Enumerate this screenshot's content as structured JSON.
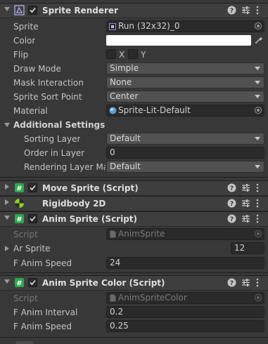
{
  "sprite_renderer": {
    "title": "Sprite Renderer",
    "sprite": {
      "label": "Sprite",
      "value": "Run (32x32)_0"
    },
    "color": {
      "label": "Color",
      "value": "#ffffff"
    },
    "flip": {
      "label": "Flip",
      "x_label": "X",
      "y_label": "Y"
    },
    "draw_mode": {
      "label": "Draw Mode",
      "value": "Simple"
    },
    "mask_interaction": {
      "label": "Mask Interaction",
      "value": "None"
    },
    "sort_point": {
      "label": "Sprite Sort Point",
      "value": "Center"
    },
    "material": {
      "label": "Material",
      "value": "Sprite-Lit-Default"
    },
    "additional": {
      "label": "Additional Settings",
      "sorting_layer": {
        "label": "Sorting Layer",
        "value": "Default"
      },
      "order_in_layer": {
        "label": "Order in Layer",
        "value": "0"
      },
      "rendering_layer": {
        "label": "Rendering Layer Mas",
        "value": "Default"
      }
    }
  },
  "move_sprite": {
    "title": "Move Sprite (Script)"
  },
  "rigidbody": {
    "title": "Rigidbody 2D"
  },
  "anim_sprite": {
    "title": "Anim Sprite (Script)",
    "script": {
      "label": "Script",
      "value": "AnimSprite"
    },
    "ar_sprite": {
      "label": "Ar Sprite",
      "value": "12"
    },
    "anim_speed": {
      "label": "F Anim Speed",
      "value": "24"
    }
  },
  "anim_sprite_color": {
    "title": "Anim Sprite Color (Script)",
    "script": {
      "label": "Script",
      "value": "AnimSpriteColor"
    },
    "anim_interval": {
      "label": "F Anim Interval",
      "value": "0.2"
    },
    "anim_speed": {
      "label": "F Anim Speed",
      "value": "0.25"
    }
  },
  "colors": {
    "background": "#383838",
    "header": "#3e3e3e",
    "field": "#2a2a2a",
    "dropdown": "#515151",
    "script_icon": "#2fa84f",
    "rigidbody_icon": "#8ed11f"
  },
  "icons": [
    "sprite-renderer-icon",
    "script-icon",
    "rigidbody-icon",
    "help-icon",
    "presets-icon",
    "kebab-icon",
    "object-picker-icon",
    "eyedropper-icon",
    "sprite-asset-icon",
    "material-icon",
    "script-asset-icon"
  ]
}
